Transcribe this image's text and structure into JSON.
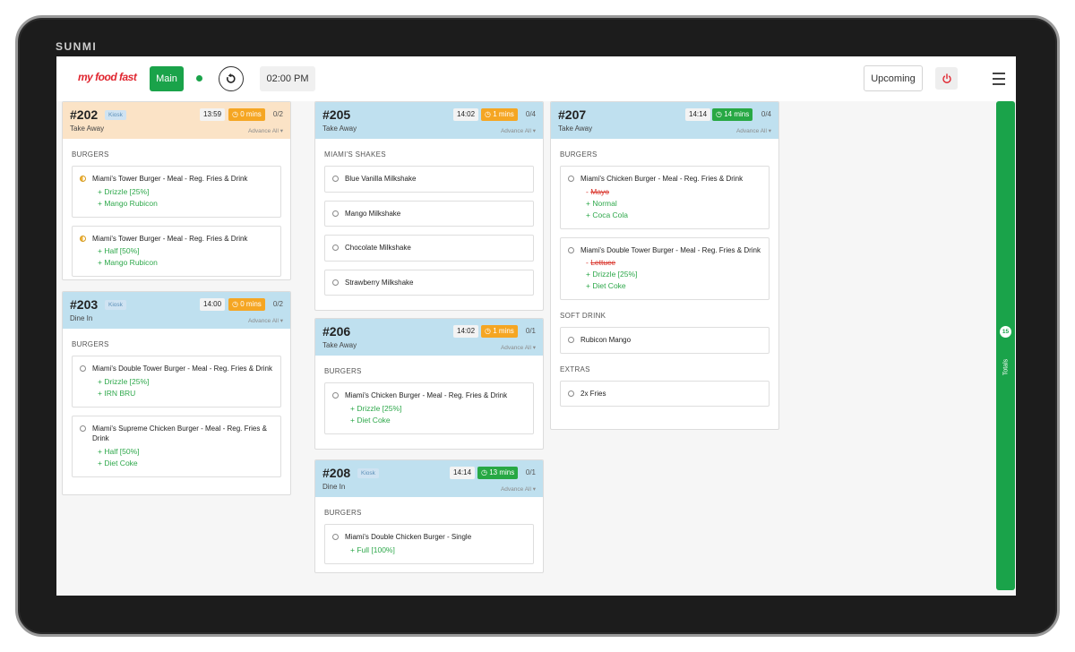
{
  "device": {
    "brand": "SUNMI"
  },
  "header": {
    "logo": "my food fast",
    "main_label": "Main",
    "time": "02:00 PM",
    "upcoming_label": "Upcoming"
  },
  "orders": [
    {
      "number": "#202",
      "kiosk": "Kiosk",
      "type": "Take Away",
      "time": "13:59",
      "timer": "0 mins",
      "count": "0/2",
      "advance": "Advance All",
      "section": "BURGERS",
      "items": [
        {
          "name": "Miami's Tower Burger - Meal - Reg. Fries & Drink",
          "mods": [
            "Drizzle [25%]",
            "Mango Rubicon"
          ]
        },
        {
          "name": "Miami's Tower Burger - Meal - Reg. Fries & Drink",
          "mods": [
            "Half [50%]",
            "Mango Rubicon"
          ]
        }
      ]
    },
    {
      "number": "#203",
      "kiosk": "Kiosk",
      "type": "Dine In",
      "time": "14:00",
      "timer": "0 mins",
      "count": "0/2",
      "advance": "Advance All",
      "section": "BURGERS",
      "items": [
        {
          "name": "Miami's Double Tower Burger - Meal - Reg. Fries & Drink",
          "mods": [
            "Drizzle [25%]",
            "IRN BRU"
          ]
        },
        {
          "name": "Miami's Supreme Chicken Burger - Meal - Reg. Fries & Drink",
          "mods": [
            "Half [50%]",
            "Diet Coke"
          ]
        }
      ]
    },
    {
      "number": "#205",
      "type": "Take Away",
      "time": "14:02",
      "timer": "1 mins",
      "count": "0/4",
      "advance": "Advance All",
      "section": "MIAMI'S SHAKES",
      "items": [
        "Blue Vanilla Milkshake",
        "Mango Milkshake",
        "Chocolate Milkshake",
        "Strawberry Milkshake"
      ]
    },
    {
      "number": "#206",
      "type": "Take Away",
      "time": "14:02",
      "timer": "1 mins",
      "count": "0/1",
      "advance": "Advance All",
      "section": "BURGERS",
      "items": [
        {
          "name": "Miami's Chicken Burger - Meal - Reg. Fries & Drink",
          "mods": [
            "Drizzle [25%]",
            "Diet Coke"
          ]
        }
      ]
    },
    {
      "number": "#208",
      "kiosk": "Kiosk",
      "type": "Dine In",
      "time": "14:14",
      "timer": "13 mins",
      "count": "0/1",
      "advance": "Advance All",
      "section": "BURGERS",
      "items": [
        {
          "name": "Miami's Double Chicken Burger - Single",
          "mods": [
            "Full [100%]"
          ]
        }
      ]
    },
    {
      "number": "#207",
      "type": "Take Away",
      "time": "14:14",
      "timer": "14 mins",
      "count": "0/4",
      "advance": "Advance All",
      "sections": [
        {
          "title": "BURGERS",
          "items": [
            {
              "name": "Miami's Chicken Burger - Meal - Reg. Fries & Drink",
              "removed": "Mayo",
              "mods": [
                "Normal",
                "Coca Cola"
              ]
            },
            {
              "name": "Miami's Double Tower Burger - Meal - Reg. Fries & Drink",
              "removed": "Lettuce",
              "mods": [
                "Drizzle [25%]",
                "Diet Coke"
              ]
            }
          ]
        },
        {
          "title": "SOFT DRINK",
          "items": [
            "Rubicon Mango"
          ]
        },
        {
          "title": "EXTRAS",
          "items": [
            "2x Fries"
          ]
        }
      ]
    }
  ],
  "totals": {
    "count": "15",
    "label": "Totals"
  },
  "colors": {
    "accent_green": "#1aa34a",
    "timer_orange": "#f5a623",
    "timer_green": "#27a844",
    "head_orange": "#fbe3c6",
    "head_blue": "#bfe0ef",
    "mod_add": "#2ea84b",
    "mod_remove": "#d9342b"
  }
}
